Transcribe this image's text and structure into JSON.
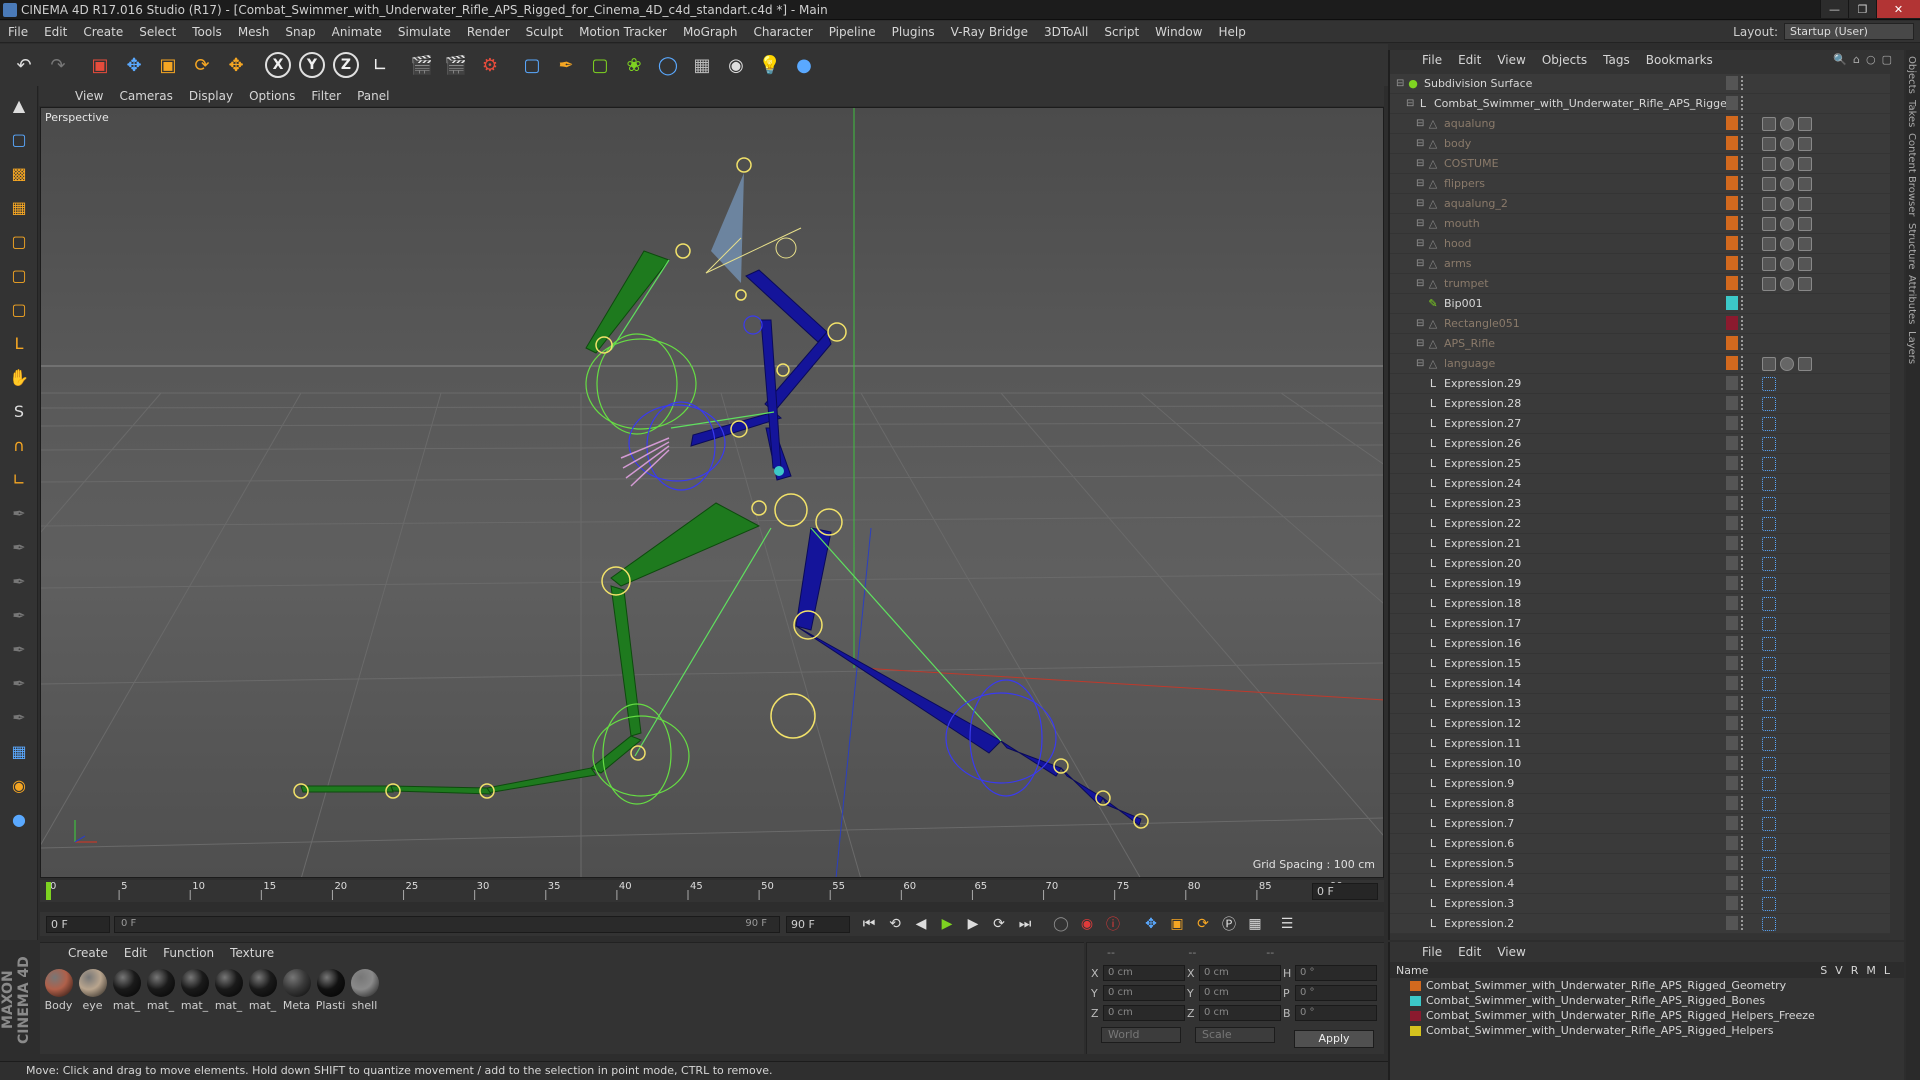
{
  "window": {
    "title": "CINEMA 4D R17.016 Studio (R17) - [Combat_Swimmer_with_Underwater_Rifle_APS_Rigged_for_Cinema_4D_c4d_standart.c4d *] - Main"
  },
  "menubar": {
    "items": [
      "File",
      "Edit",
      "Create",
      "Select",
      "Tools",
      "Mesh",
      "Snap",
      "Animate",
      "Simulate",
      "Render",
      "Sculpt",
      "Motion Tracker",
      "MoGraph",
      "Character",
      "Pipeline",
      "Plugins",
      "V-Ray Bridge",
      "3DToAll",
      "Script",
      "Window",
      "Help"
    ],
    "layout_label": "Layout:",
    "layout_value": "Startup (User)"
  },
  "viewport": {
    "menu": [
      "View",
      "Cameras",
      "Display",
      "Options",
      "Filter",
      "Panel"
    ],
    "label": "Perspective",
    "grid_spacing": "Grid Spacing : 100 cm"
  },
  "timeline": {
    "ticks": [
      "0",
      "5",
      "10",
      "15",
      "20",
      "25",
      "30",
      "35",
      "40",
      "45",
      "50",
      "55",
      "60",
      "65",
      "70",
      "75",
      "80",
      "85",
      "90"
    ],
    "end_field": "0 F",
    "start_field": "0 F",
    "range_start": "0 F",
    "range_end": "90 F",
    "max_field": "90 F"
  },
  "materials": {
    "menu": [
      "Create",
      "Edit",
      "Function",
      "Texture"
    ],
    "items": [
      {
        "label": "Body",
        "color": "#b0604a"
      },
      {
        "label": "eye",
        "color": "#b9a58e"
      },
      {
        "label": "mat_",
        "color": "#1a1a1a"
      },
      {
        "label": "mat_",
        "color": "#1a1a1a"
      },
      {
        "label": "mat_",
        "color": "#1a1a1a"
      },
      {
        "label": "mat_",
        "color": "#1a1a1a"
      },
      {
        "label": "mat_",
        "color": "#1a1a1a"
      },
      {
        "label": "Meta",
        "color": "#3a3a3a"
      },
      {
        "label": "Plasti",
        "color": "#111111"
      },
      {
        "label": "shell",
        "color": "#8a8a8a"
      }
    ]
  },
  "coords": {
    "rows": [
      {
        "a": "X",
        "v1": "0 cm",
        "b": "X",
        "v2": "0 cm",
        "c": "H",
        "v3": "0 °"
      },
      {
        "a": "Y",
        "v1": "0 cm",
        "b": "Y",
        "v2": "0 cm",
        "c": "P",
        "v3": "0 °"
      },
      {
        "a": "Z",
        "v1": "0 cm",
        "b": "Z",
        "v2": "0 cm",
        "c": "B",
        "v3": "0 °"
      }
    ],
    "mode1": "World",
    "mode2": "Scale",
    "apply": "Apply"
  },
  "status": "Move: Click and drag to move elements. Hold down SHIFT to quantize movement / add to the selection in point mode, CTRL to remove.",
  "objects": {
    "menu": [
      "File",
      "Edit",
      "View",
      "Objects",
      "Tags",
      "Bookmarks"
    ],
    "rows": [
      {
        "name": "Subdivision Surface",
        "dim": false,
        "indent": 0,
        "icon": "●",
        "color": "#7ed321"
      },
      {
        "name": "Combat_Swimmer_with_Underwater_Rifle_APS_Rigged",
        "dim": false,
        "indent": 1,
        "icon": "L",
        "color": "#d8d8d8"
      },
      {
        "name": "aqualung",
        "dim": true,
        "indent": 2,
        "icon": "△",
        "color": "#888"
      },
      {
        "name": "body",
        "dim": true,
        "indent": 2,
        "icon": "△",
        "color": "#888"
      },
      {
        "name": "COSTUME",
        "dim": true,
        "indent": 2,
        "icon": "△",
        "color": "#888"
      },
      {
        "name": "flippers",
        "dim": true,
        "indent": 2,
        "icon": "△",
        "color": "#888"
      },
      {
        "name": "aqualung_2",
        "dim": true,
        "indent": 2,
        "icon": "△",
        "color": "#888"
      },
      {
        "name": "mouth",
        "dim": true,
        "indent": 2,
        "icon": "△",
        "color": "#888"
      },
      {
        "name": "hood",
        "dim": true,
        "indent": 2,
        "icon": "△",
        "color": "#888"
      },
      {
        "name": "arms",
        "dim": true,
        "indent": 2,
        "icon": "△",
        "color": "#888"
      },
      {
        "name": "trumpet",
        "dim": true,
        "indent": 2,
        "icon": "△",
        "color": "#888"
      },
      {
        "name": "Bip001",
        "dim": false,
        "indent": 2,
        "icon": "✎",
        "color": "#7ed321"
      },
      {
        "name": "Rectangle051",
        "dim": true,
        "indent": 2,
        "icon": "△",
        "color": "#888"
      },
      {
        "name": "APS_Rifle",
        "dim": true,
        "indent": 2,
        "icon": "△",
        "color": "#888"
      },
      {
        "name": "language",
        "dim": true,
        "indent": 2,
        "icon": "△",
        "color": "#888"
      },
      {
        "name": "Expression.29",
        "dim": false,
        "indent": 2,
        "icon": "L",
        "color": "#d8d8d8"
      },
      {
        "name": "Expression.28",
        "dim": false,
        "indent": 2,
        "icon": "L",
        "color": "#d8d8d8"
      },
      {
        "name": "Expression.27",
        "dim": false,
        "indent": 2,
        "icon": "L",
        "color": "#d8d8d8"
      },
      {
        "name": "Expression.26",
        "dim": false,
        "indent": 2,
        "icon": "L",
        "color": "#d8d8d8"
      },
      {
        "name": "Expression.25",
        "dim": false,
        "indent": 2,
        "icon": "L",
        "color": "#d8d8d8"
      },
      {
        "name": "Expression.24",
        "dim": false,
        "indent": 2,
        "icon": "L",
        "color": "#d8d8d8"
      },
      {
        "name": "Expression.23",
        "dim": false,
        "indent": 2,
        "icon": "L",
        "color": "#d8d8d8"
      },
      {
        "name": "Expression.22",
        "dim": false,
        "indent": 2,
        "icon": "L",
        "color": "#d8d8d8"
      },
      {
        "name": "Expression.21",
        "dim": false,
        "indent": 2,
        "icon": "L",
        "color": "#d8d8d8"
      },
      {
        "name": "Expression.20",
        "dim": false,
        "indent": 2,
        "icon": "L",
        "color": "#d8d8d8"
      },
      {
        "name": "Expression.19",
        "dim": false,
        "indent": 2,
        "icon": "L",
        "color": "#d8d8d8"
      },
      {
        "name": "Expression.18",
        "dim": false,
        "indent": 2,
        "icon": "L",
        "color": "#d8d8d8"
      },
      {
        "name": "Expression.17",
        "dim": false,
        "indent": 2,
        "icon": "L",
        "color": "#d8d8d8"
      },
      {
        "name": "Expression.16",
        "dim": false,
        "indent": 2,
        "icon": "L",
        "color": "#d8d8d8"
      },
      {
        "name": "Expression.15",
        "dim": false,
        "indent": 2,
        "icon": "L",
        "color": "#d8d8d8"
      },
      {
        "name": "Expression.14",
        "dim": false,
        "indent": 2,
        "icon": "L",
        "color": "#d8d8d8"
      },
      {
        "name": "Expression.13",
        "dim": false,
        "indent": 2,
        "icon": "L",
        "color": "#d8d8d8"
      },
      {
        "name": "Expression.12",
        "dim": false,
        "indent": 2,
        "icon": "L",
        "color": "#d8d8d8"
      },
      {
        "name": "Expression.11",
        "dim": false,
        "indent": 2,
        "icon": "L",
        "color": "#d8d8d8"
      },
      {
        "name": "Expression.10",
        "dim": false,
        "indent": 2,
        "icon": "L",
        "color": "#d8d8d8"
      },
      {
        "name": "Expression.9",
        "dim": false,
        "indent": 2,
        "icon": "L",
        "color": "#d8d8d8"
      },
      {
        "name": "Expression.8",
        "dim": false,
        "indent": 2,
        "icon": "L",
        "color": "#d8d8d8"
      },
      {
        "name": "Expression.7",
        "dim": false,
        "indent": 2,
        "icon": "L",
        "color": "#d8d8d8"
      },
      {
        "name": "Expression.6",
        "dim": false,
        "indent": 2,
        "icon": "L",
        "color": "#d8d8d8"
      },
      {
        "name": "Expression.5",
        "dim": false,
        "indent": 2,
        "icon": "L",
        "color": "#d8d8d8"
      },
      {
        "name": "Expression.4",
        "dim": false,
        "indent": 2,
        "icon": "L",
        "color": "#d8d8d8"
      },
      {
        "name": "Expression.3",
        "dim": false,
        "indent": 2,
        "icon": "L",
        "color": "#d8d8d8"
      },
      {
        "name": "Expression.2",
        "dim": false,
        "indent": 2,
        "icon": "L",
        "color": "#d8d8d8"
      }
    ]
  },
  "layers": {
    "menu": [
      "File",
      "Edit",
      "View"
    ],
    "header_name": "Name",
    "header_cols": [
      "S",
      "V",
      "R",
      "M",
      "L"
    ],
    "rows": [
      {
        "name": "Combat_Swimmer_with_Underwater_Rifle_APS_Rigged_Geometry",
        "color": "#d2691e"
      },
      {
        "name": "Combat_Swimmer_with_Underwater_Rifle_APS_Rigged_Bones",
        "color": "#3cc8c8"
      },
      {
        "name": "Combat_Swimmer_with_Underwater_Rifle_APS_Rigged_Helpers_Freeze",
        "color": "#8b1a2e"
      },
      {
        "name": "Combat_Swimmer_with_Underwater_Rifle_APS_Rigged_Helpers",
        "color": "#d4c21e"
      }
    ]
  },
  "sidetabs": [
    "Objects",
    "Takes",
    "Content Browser",
    "Structure",
    "Attributes",
    "Layers"
  ]
}
